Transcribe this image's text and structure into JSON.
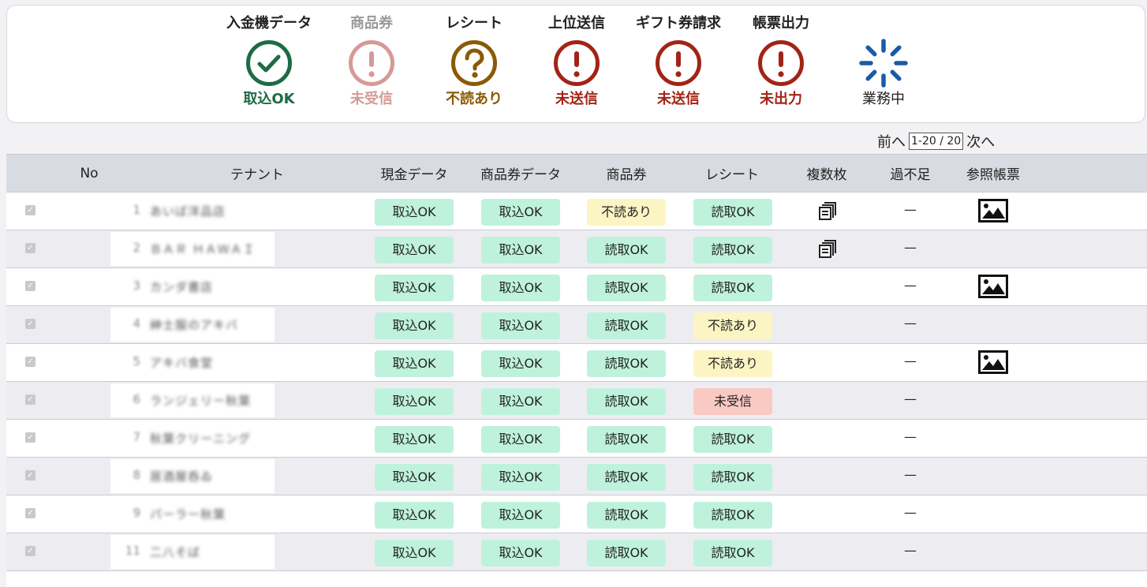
{
  "status_bar": [
    {
      "title": "入金機データ",
      "label": "取込OK",
      "icon": "check-circle-icon",
      "color": "#1e6b46",
      "title_color": "#222"
    },
    {
      "title": "商品券",
      "label": "未受信",
      "icon": "exclamation-circle-icon",
      "color": "#d59a97",
      "title_color": "#999"
    },
    {
      "title": "レシート",
      "label": "不読あり",
      "icon": "question-circle-icon",
      "color": "#8a5a06",
      "title_color": "#222"
    },
    {
      "title": "上位送信",
      "label": "未送信",
      "icon": "exclamation-circle-icon",
      "color": "#a22416",
      "title_color": "#222"
    },
    {
      "title": "ギフト券請求",
      "label": "未送信",
      "icon": "exclamation-circle-icon",
      "color": "#a22416",
      "title_color": "#222"
    },
    {
      "title": "帳票出力",
      "label": "未出力",
      "icon": "exclamation-circle-icon",
      "color": "#a22416",
      "title_color": "#222"
    },
    {
      "title": "",
      "label": "業務中",
      "icon": "spinner-icon",
      "color": "#1c5aa8",
      "title_color": "#222"
    }
  ],
  "pager": {
    "prev": "前へ",
    "range": "1-20 / 20",
    "next": "次へ"
  },
  "columns": {
    "no": "No",
    "tenant": "テナント",
    "cash": "現金データ",
    "voucher_data": "商品券データ",
    "voucher": "商品券",
    "receipt": "レシート",
    "multiple": "複数枚",
    "shortage": "過不足",
    "reference": "参照帳票"
  },
  "rows": [
    {
      "no": "1",
      "tenant": "あいば洋品店",
      "cash": "取込OK",
      "voucher_data": "取込OK",
      "voucher": "不読あり",
      "receipt": "読取OK",
      "multiple": true,
      "shortage": "—",
      "reference": true
    },
    {
      "no": "2",
      "tenant": "ＢＡＲ ＨＡＷＡＩ",
      "cash": "取込OK",
      "voucher_data": "取込OK",
      "voucher": "読取OK",
      "receipt": "読取OK",
      "multiple": true,
      "shortage": "—",
      "reference": false
    },
    {
      "no": "3",
      "tenant": "カンダ書店",
      "cash": "取込OK",
      "voucher_data": "取込OK",
      "voucher": "読取OK",
      "receipt": "読取OK",
      "multiple": false,
      "shortage": "—",
      "reference": true
    },
    {
      "no": "4",
      "tenant": "紳士服のアキバ",
      "cash": "取込OK",
      "voucher_data": "取込OK",
      "voucher": "読取OK",
      "receipt": "不読あり",
      "multiple": false,
      "shortage": "—",
      "reference": false
    },
    {
      "no": "5",
      "tenant": "アキバ食堂",
      "cash": "取込OK",
      "voucher_data": "取込OK",
      "voucher": "読取OK",
      "receipt": "不読あり",
      "multiple": false,
      "shortage": "—",
      "reference": true
    },
    {
      "no": "6",
      "tenant": "ランジェリー秋葉",
      "cash": "取込OK",
      "voucher_data": "取込OK",
      "voucher": "読取OK",
      "receipt": "未受信",
      "multiple": false,
      "shortage": "—",
      "reference": false
    },
    {
      "no": "7",
      "tenant": "秋葉クリーニング",
      "cash": "取込OK",
      "voucher_data": "取込OK",
      "voucher": "読取OK",
      "receipt": "読取OK",
      "multiple": false,
      "shortage": "—",
      "reference": false
    },
    {
      "no": "8",
      "tenant": "居酒屋呑ゐ",
      "cash": "取込OK",
      "voucher_data": "取込OK",
      "voucher": "読取OK",
      "receipt": "読取OK",
      "multiple": false,
      "shortage": "—",
      "reference": false
    },
    {
      "no": "9",
      "tenant": "パーラー秋葉",
      "cash": "取込OK",
      "voucher_data": "取込OK",
      "voucher": "読取OK",
      "receipt": "読取OK",
      "multiple": false,
      "shortage": "—",
      "reference": false
    },
    {
      "no": "11",
      "tenant": "二八そば",
      "cash": "取込OK",
      "voucher_data": "取込OK",
      "voucher": "読取OK",
      "receipt": "読取OK",
      "multiple": false,
      "shortage": "—",
      "reference": false
    }
  ]
}
